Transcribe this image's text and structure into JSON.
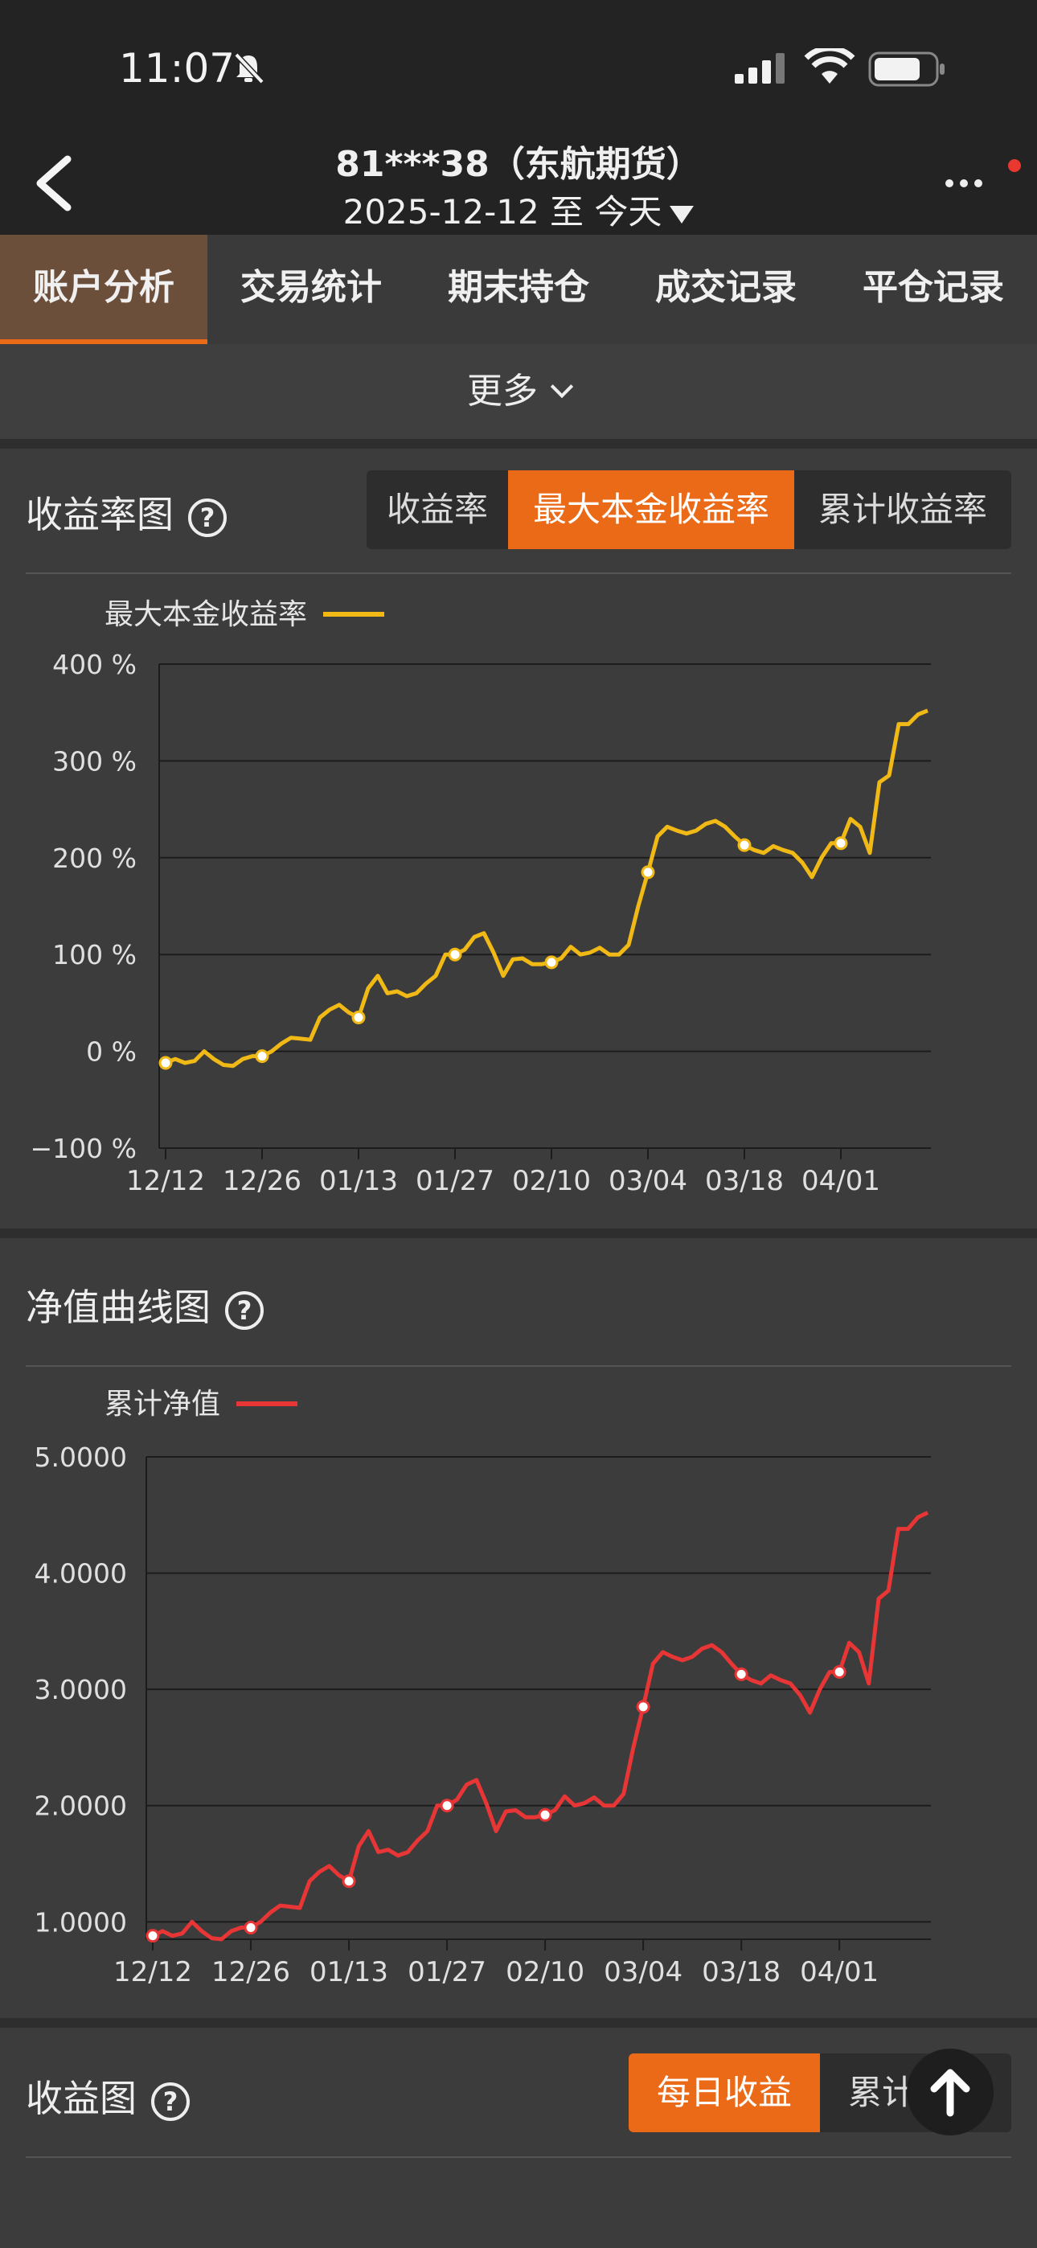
{
  "status": {
    "time": "11:07"
  },
  "header": {
    "title": "81***38（东航期货）",
    "date_range": "2025-12-12 至 今天"
  },
  "tabs": [
    "账户分析",
    "交易统计",
    "期末持仓",
    "成交记录",
    "平仓记录"
  ],
  "more_label": "更多",
  "return_section": {
    "title": "收益率图",
    "toggle": [
      "收益率",
      "最大本金收益率",
      "累计收益率"
    ],
    "active_toggle": "最大本金收益率"
  },
  "nav_section": {
    "title": "净值曲线图"
  },
  "profit_section": {
    "title": "收益图",
    "toggle": [
      "每日收益",
      "累计收益"
    ],
    "active_toggle": "每日收益"
  },
  "colors": {
    "accent": "#ea6a18",
    "yellow": "#f0b915",
    "red": "#e83535"
  },
  "chart_data": [
    {
      "type": "line",
      "legend": "最大本金收益率",
      "ylim": [
        -100,
        400
      ],
      "yticks": [
        "400 %",
        "300 %",
        "200 %",
        "100 %",
        "0 %",
        "−100 %"
      ],
      "yvals": [
        400,
        300,
        200,
        100,
        0,
        -100
      ],
      "xticks": [
        "12/12",
        "12/26",
        "01/13",
        "01/27",
        "02/10",
        "03/04",
        "03/18",
        "04/01"
      ],
      "xtick_idx": [
        0,
        10,
        20,
        30,
        40,
        50,
        60,
        70
      ],
      "marker_idx": [
        0,
        10,
        20,
        30,
        40,
        50,
        60,
        70
      ],
      "n_points": 80,
      "values": [
        -12,
        -8,
        -12,
        -10,
        0,
        -8,
        -14,
        -15,
        -8,
        -5,
        -5,
        0,
        8,
        14,
        13,
        12,
        35,
        43,
        48,
        40,
        35,
        65,
        78,
        60,
        62,
        57,
        60,
        70,
        78,
        100,
        100,
        105,
        118,
        122,
        102,
        78,
        95,
        96,
        90,
        90,
        92,
        96,
        108,
        100,
        102,
        107,
        100,
        100,
        110,
        150,
        185,
        222,
        232,
        228,
        225,
        228,
        235,
        238,
        232,
        222,
        213,
        208,
        205,
        212,
        208,
        205,
        195,
        180,
        200,
        215,
        215,
        240,
        232,
        205,
        278,
        285,
        338,
        338,
        348,
        352
      ]
    },
    {
      "type": "line",
      "legend": "累计净值",
      "ylim": [
        0.85,
        5.0
      ],
      "yticks": [
        "5.0000",
        "4.0000",
        "3.0000",
        "2.0000",
        "1.0000"
      ],
      "yvals": [
        5,
        4,
        3,
        2,
        1
      ],
      "xticks": [
        "12/12",
        "12/26",
        "01/13",
        "01/27",
        "02/10",
        "03/04",
        "03/18",
        "04/01"
      ],
      "xtick_idx": [
        0,
        10,
        20,
        30,
        40,
        50,
        60,
        70
      ],
      "marker_idx": [
        0,
        10,
        20,
        30,
        40,
        50,
        60,
        70
      ],
      "n_points": 80,
      "values": [
        0.88,
        0.92,
        0.88,
        0.9,
        1.0,
        0.92,
        0.86,
        0.85,
        0.92,
        0.95,
        0.95,
        1.0,
        1.08,
        1.14,
        1.13,
        1.12,
        1.35,
        1.43,
        1.48,
        1.4,
        1.35,
        1.65,
        1.78,
        1.6,
        1.62,
        1.57,
        1.6,
        1.7,
        1.78,
        2.0,
        2.0,
        2.05,
        2.18,
        2.22,
        2.02,
        1.78,
        1.95,
        1.96,
        1.9,
        1.9,
        1.92,
        1.96,
        2.08,
        2.0,
        2.02,
        2.07,
        2.0,
        2.0,
        2.1,
        2.5,
        2.85,
        3.22,
        3.32,
        3.28,
        3.25,
        3.28,
        3.35,
        3.38,
        3.32,
        3.22,
        3.13,
        3.08,
        3.05,
        3.12,
        3.08,
        3.05,
        2.95,
        2.8,
        3.0,
        3.15,
        3.15,
        3.4,
        3.32,
        3.05,
        3.78,
        3.85,
        4.38,
        4.38,
        4.48,
        4.52
      ]
    }
  ]
}
